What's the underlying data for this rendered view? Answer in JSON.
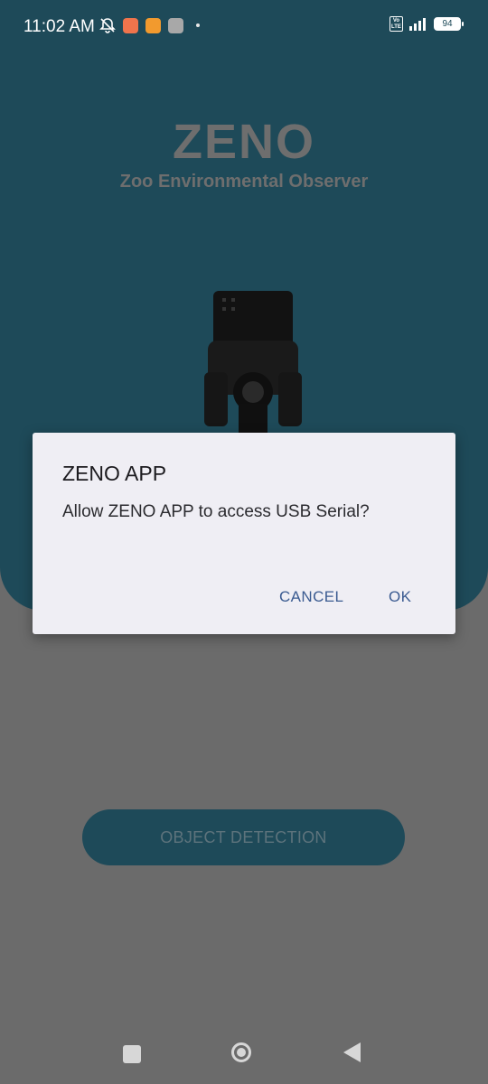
{
  "status_bar": {
    "time": "11:02 AM",
    "icons": [
      "bell-off-icon",
      "app-notification-icon",
      "app-notification-icon",
      "app-notification-icon",
      "dot-icon"
    ],
    "volte_label": "Vo LTE",
    "battery": "94"
  },
  "hero": {
    "logo_title": "ZENO",
    "logo_subtitle": "Zoo Environmental Observer"
  },
  "main": {
    "object_detection_label": "OBJECT DETECTION"
  },
  "dialog": {
    "title": "ZENO APP",
    "message": "Allow ZENO APP to access USB Serial?",
    "cancel_label": "CANCEL",
    "ok_label": "OK"
  },
  "colors": {
    "primary": "#1e4a59",
    "scrim_background": "#6b6b6b",
    "dialog_background": "#efeef4",
    "dialog_button": "#3b5b91"
  },
  "nav_bar": {
    "icons": [
      "recents-icon",
      "home-icon",
      "back-icon"
    ]
  }
}
